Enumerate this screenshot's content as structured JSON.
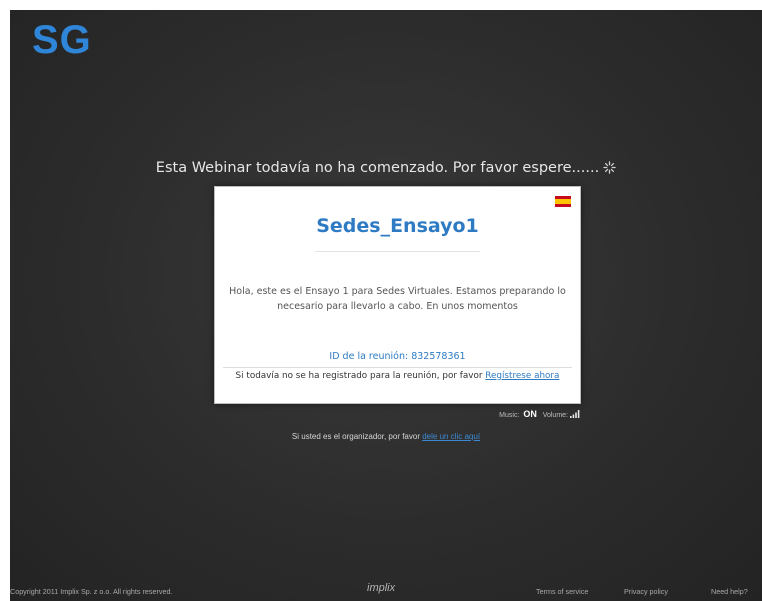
{
  "app": {
    "logo_text": "SG"
  },
  "status": {
    "headline": "Esta Webinar todavía no ha comenzado.  Por favor espere......"
  },
  "room": {
    "title": "Sedes_Ensayo1",
    "description": "Hola, este es el Ensayo 1 para Sedes Virtuales. Estamos preparando lo necesario para llevarlo a cabo. En unos momentos",
    "meeting_id": "ID de la reunión: 832578361",
    "register_prompt": "Si todavía no se ha registrado para la reunión, por favor",
    "register_link": "Regístrese ahora"
  },
  "audio": {
    "music_label": "Music:",
    "music_value": "ON",
    "volume_label": "Volume:"
  },
  "organizer": {
    "prompt": "Si usted es el organizador, por favor",
    "link": "dele un clic aquí"
  },
  "footer": {
    "copyright": "Copyright 2011 Implix Sp. z o.o. All rights reserved.",
    "brand": "implix",
    "terms": "Terms of service",
    "privacy": "Privacy policy",
    "help": "Need help?"
  },
  "colors": {
    "accent": "#2e7bc4",
    "logo": "#2f86d8",
    "background": "#2c2c2c"
  },
  "icons": {
    "loading": "loading-spinner-icon",
    "flag": "spain-flag-icon",
    "volume": "volume-icon"
  }
}
